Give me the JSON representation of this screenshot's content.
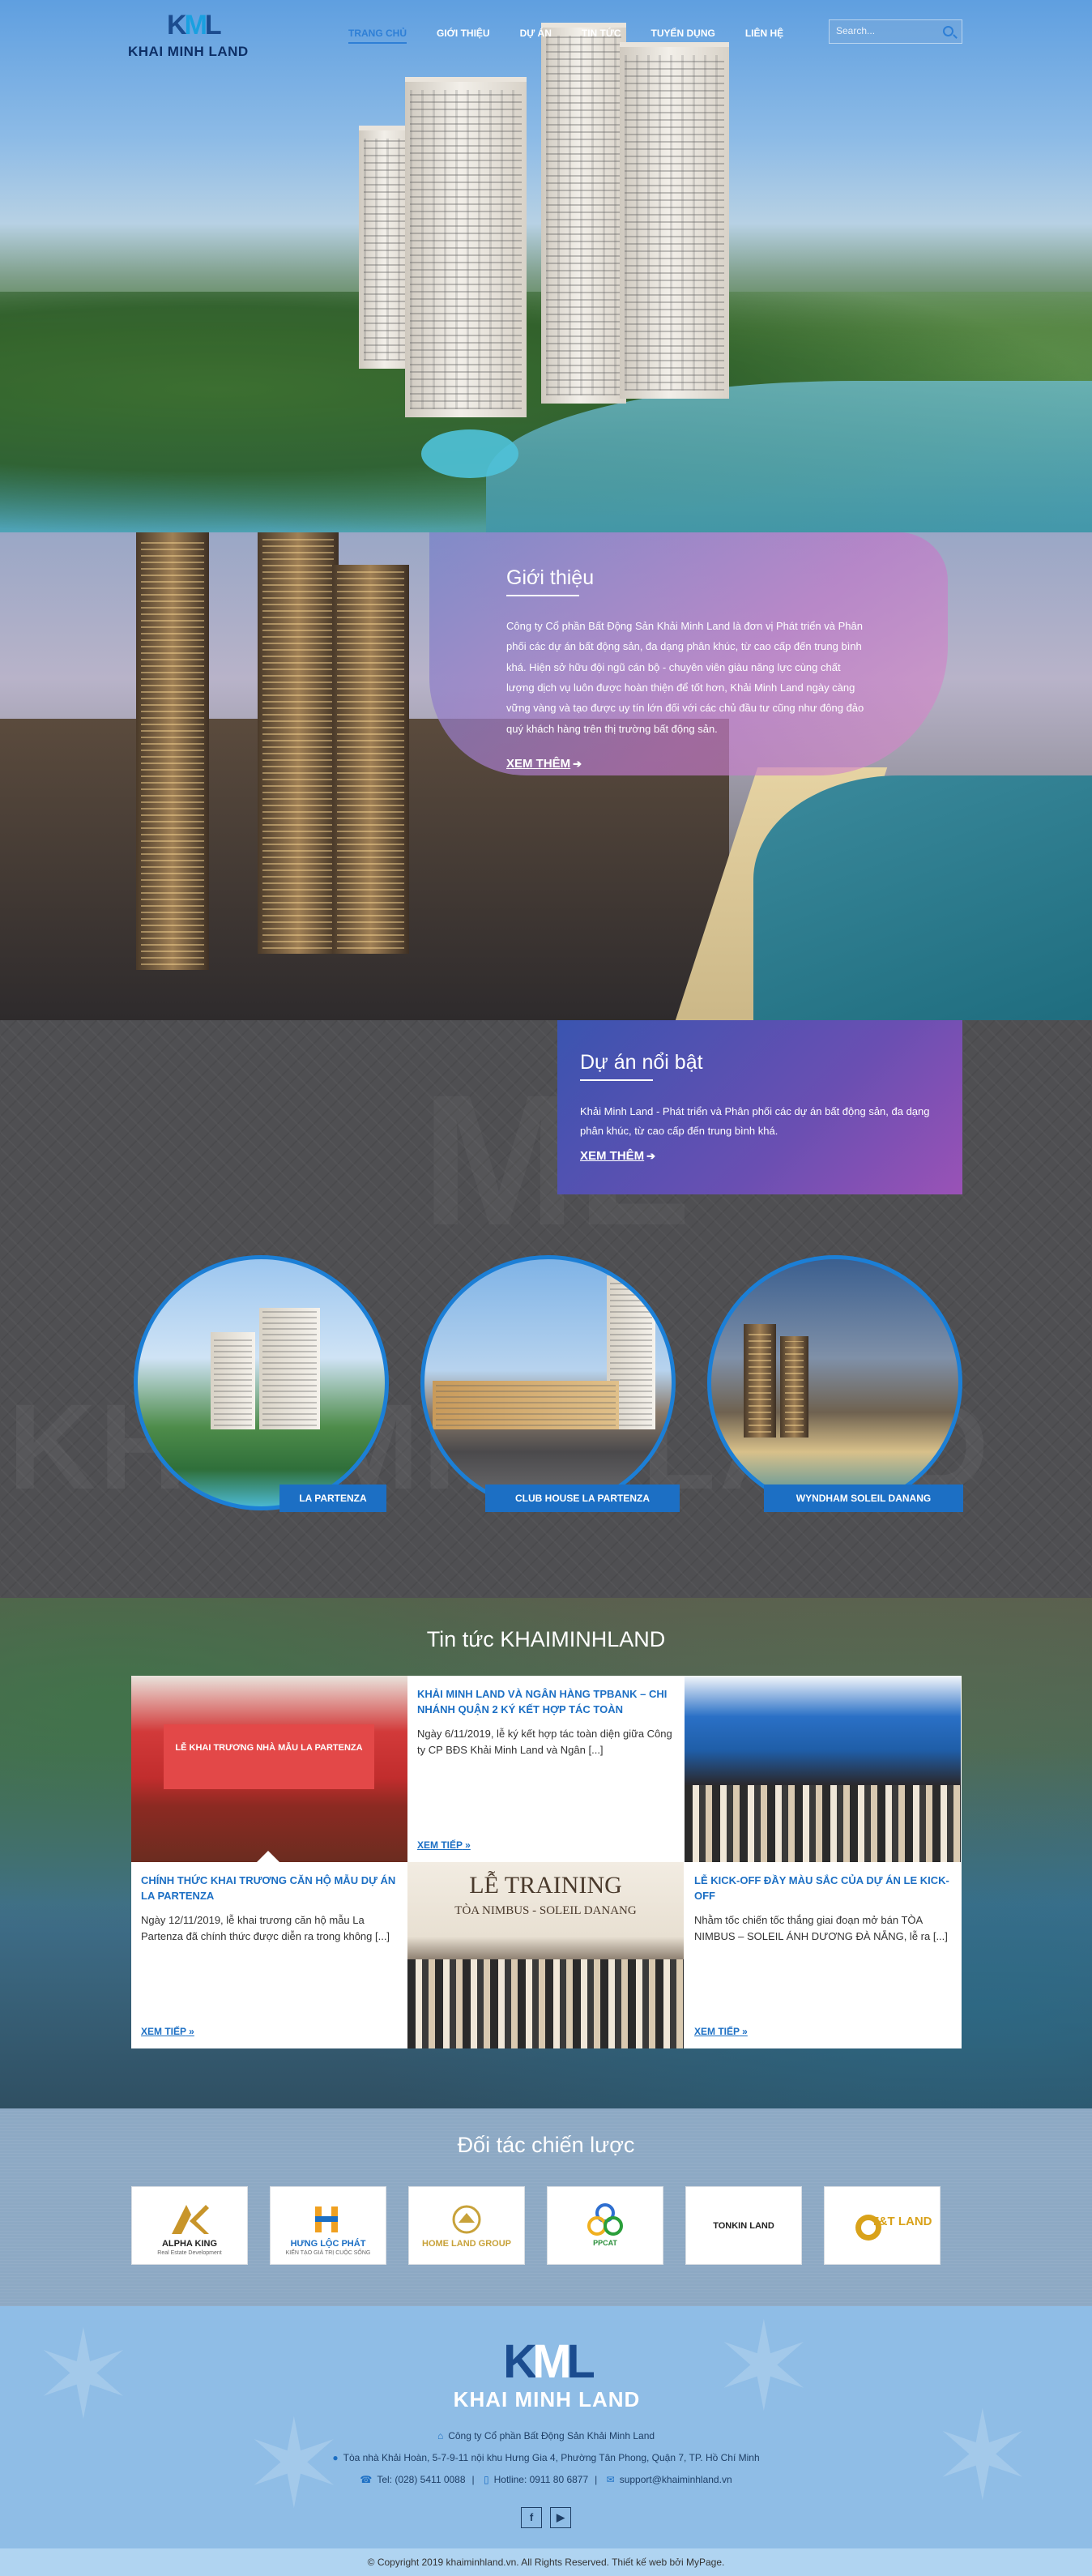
{
  "brand": {
    "logo_mark": "KML",
    "logo_word": "KHAI MINH LAND"
  },
  "nav": {
    "items": [
      {
        "label": "TRANG CHỦ",
        "active": true
      },
      {
        "label": "GIỚI THIỆU",
        "active": false
      },
      {
        "label": "DỰ ÁN",
        "active": false
      },
      {
        "label": "TIN TỨC",
        "active": false
      },
      {
        "label": "TUYỂN DỤNG",
        "active": false
      },
      {
        "label": "LIÊN HỆ",
        "active": false
      }
    ],
    "search_placeholder": "Search..."
  },
  "intro": {
    "title": "Giới thiệu",
    "text": "Công ty Cổ phần Bất Động Sản Khải Minh Land là đơn vị Phát triển và Phân phối các dự án bất động sản, đa dạng phân khúc, từ cao cấp đến trung bình khá. Hiện sở hữu đội ngũ cán bộ - chuyên viên giàu năng lực cùng chất lượng dịch vụ luôn được hoàn thiện để tốt hơn, Khải Minh Land ngày càng vững vàng và tạo được uy tín lớn đối với các chủ đầu tư cũng như đông đảo quý khách hàng trên thị trường bất động sản.",
    "more": "XEM THÊM"
  },
  "featured": {
    "title": "Dự án nổi bật",
    "text": "Khải Minh Land - Phát triển và Phân phối các dự án bất động sản, đa dạng phân khúc, từ cao cấp đến trung bình khá.",
    "more": "XEM THÊM",
    "watermark": "KHAIMINHLAND",
    "projects": [
      {
        "label": "LA PARTENZA"
      },
      {
        "label": "CLUB HOUSE LA PARTENZA"
      },
      {
        "label": "WYNDHAM SOLEIL DANANG"
      }
    ]
  },
  "news": {
    "title": "Tin tức KHAIMINHLAND",
    "read_more": "XEM TIẾP",
    "items": [
      {
        "title": "KHẢI MINH LAND VÀ NGÂN HÀNG TPBANK – CHI NHÁNH QUẬN 2 KÝ KẾT HỢP TÁC TOÀN",
        "excerpt": "Ngày 6/11/2019, lễ ký kết hợp tác toàn diện giữa Công ty CP BĐS Khải Minh Land và Ngân [...]"
      },
      {
        "title": "CHÍNH THỨC KHAI TRƯƠNG CĂN HỘ MẪU DỰ ÁN LA PARTENZA",
        "excerpt": "Ngày 12/11/2019, lễ khai trương căn hộ mẫu La Partenza đã chính thức được diễn ra trong không [...]"
      },
      {
        "title": "LỄ KICK-OFF ĐẦY MÀU SẮC CỦA DỰ ÁN LE KICK-OFF",
        "excerpt": "Nhằm tốc chiến tốc thắng giai đoạn mở bán TÒA NIMBUS – SOLEIL ÁNH DƯƠNG ĐÀ NẴNG, lễ ra [...]"
      }
    ],
    "img_banner": "LỄ KHAI TRƯƠNG NHÀ MẪU LA PARTENZA",
    "img_training": "LỄ TRAINING",
    "img_training_sub": "TÒA NIMBUS - SOLEIL DANANG"
  },
  "partners": {
    "title": "Đối tác chiến lược",
    "items": [
      {
        "name": "ALPHA KING",
        "sub": "Real Estate Development",
        "color": "#c8952a"
      },
      {
        "name": "HƯNG LỘC PHÁT",
        "sub": "KIẾN TẠO GIÁ TRỊ CUỘC SỐNG",
        "color": "#1c6fc4"
      },
      {
        "name": "HOME LAND GROUP",
        "sub": "",
        "color": "#c8a23a"
      },
      {
        "name": "PPCAT",
        "sub": "",
        "color": "#2a8f3a"
      },
      {
        "name": "TONKIN LAND",
        "sub": "",
        "color": "#222222"
      },
      {
        "name": "T&T LAND",
        "sub": "",
        "color": "#d9a21a"
      }
    ]
  },
  "footer": {
    "company": "Công ty Cổ phần Bất Động Sản Khải Minh Land",
    "address": "Tòa nhà Khải Hoàn, 5-7-9-11 nội khu Hưng Gia 4, Phường Tân Phong, Quận 7, TP. Hồ Chí Minh",
    "tel": "Tel: (028) 5411 0088",
    "hotline": "Hotline: 0911 80 6877",
    "email": "support@khaiminhland.vn",
    "copyright": "© Copyright 2019 khaiminhland.vn. All Rights Reserved. Thiết kế web bởi MyPage."
  }
}
